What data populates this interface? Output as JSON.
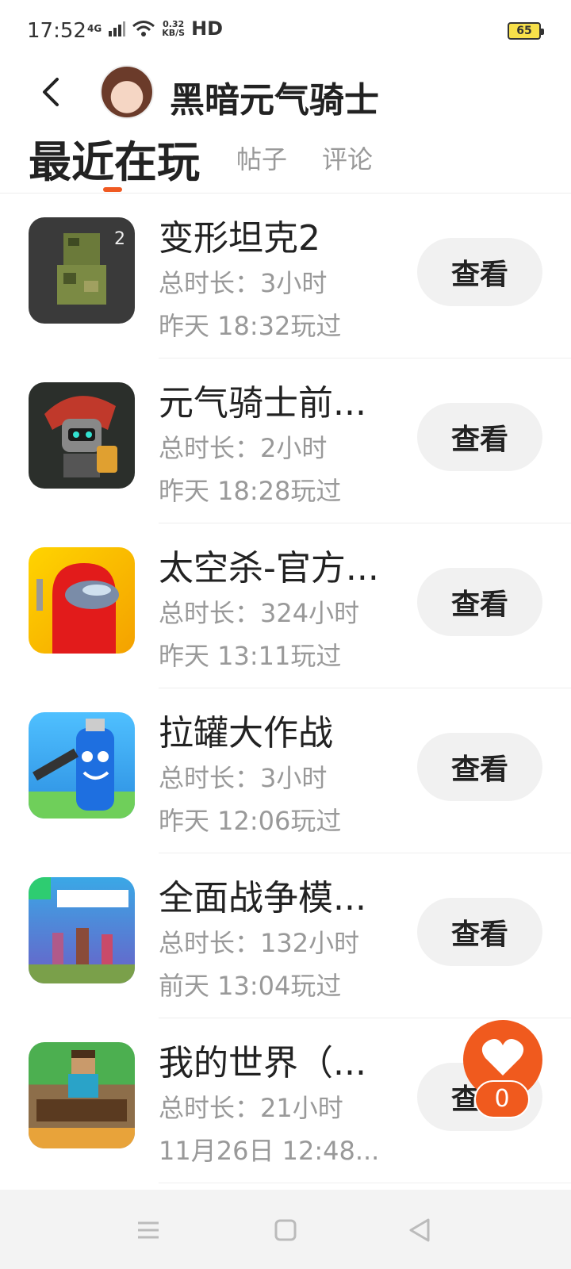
{
  "status_bar": {
    "time": "17:52",
    "network": "4G",
    "speed_value": "0.32",
    "speed_unit": "KB/S",
    "hd": "HD",
    "battery": "65"
  },
  "header": {
    "title": "黑暗元气骑士",
    "back_icon": "back-arrow-icon",
    "avatar": "avatar"
  },
  "tabs": [
    {
      "label": "最近在玩",
      "active": true
    },
    {
      "label": "帖子",
      "active": false
    },
    {
      "label": "评论",
      "active": false
    }
  ],
  "games": [
    {
      "name": "变形坦克2",
      "duration": "总时长：3小时",
      "last_played": "昨天 18:32玩过",
      "button": "查看"
    },
    {
      "name": "元气骑士前...",
      "duration": "总时长：2小时",
      "last_played": "昨天 18:28玩过",
      "button": "查看"
    },
    {
      "name": "太空杀-官方...",
      "duration": "总时长：324小时",
      "last_played": "昨天 13:11玩过",
      "button": "查看"
    },
    {
      "name": "拉罐大作战",
      "duration": "总时长：3小时",
      "last_played": "昨天 12:06玩过",
      "button": "查看"
    },
    {
      "name": "全面战争模...",
      "duration": "总时长：132小时",
      "last_played": "前天 13:04玩过",
      "button": "查看"
    },
    {
      "name": "我的世界（...",
      "duration": "总时长：21小时",
      "last_played": "11月26日 12:48...",
      "button": "查看"
    }
  ],
  "like_fab": {
    "count": "0"
  },
  "colors": {
    "accent": "#f05a22",
    "button_bg": "#f1f1f1",
    "muted_text": "#999999"
  }
}
